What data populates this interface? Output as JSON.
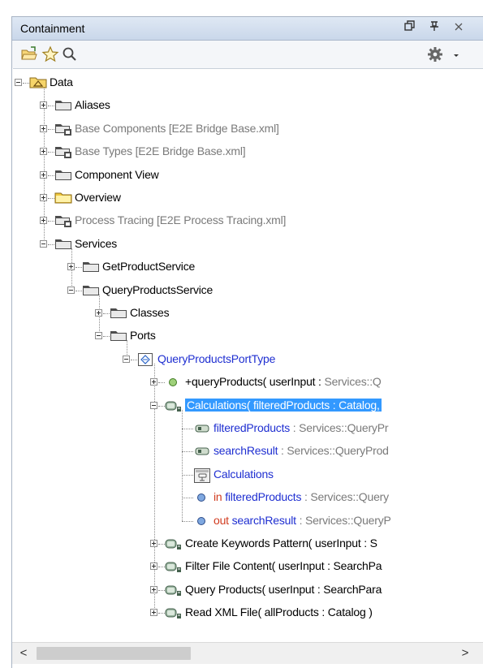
{
  "panel": {
    "title": "Containment",
    "buttons": {
      "restore": "⊡",
      "pin": "⊥",
      "close": "✕"
    }
  },
  "toolbar": {
    "icons": [
      "open-folder-icon",
      "star-icon",
      "search-icon",
      "gear-icon",
      "dropdown-arrow-icon"
    ]
  },
  "tree": {
    "nodes": [
      {
        "label": "Data",
        "type": "package-root"
      },
      {
        "label": "Aliases",
        "type": "package"
      },
      {
        "label": "Base Components [E2E Bridge Base.xml]",
        "type": "package-linked",
        "muted": true
      },
      {
        "label": "Base Types [E2E Bridge Base.xml]",
        "type": "package-linked",
        "muted": true
      },
      {
        "label": "Component View",
        "type": "package"
      },
      {
        "label": "Overview",
        "type": "package-yellow"
      },
      {
        "label": "Process Tracing [E2E Process Tracing.xml]",
        "type": "package-linked",
        "muted": true
      },
      {
        "label": "Services",
        "type": "package"
      },
      {
        "label": "GetProductService",
        "type": "package"
      },
      {
        "label": "QueryProductsService",
        "type": "package"
      },
      {
        "label": "Classes",
        "type": "package"
      },
      {
        "label": "Ports",
        "type": "package"
      },
      {
        "label": "QueryProductsPortType",
        "type": "port-type"
      },
      {
        "label": "+queryProducts( userInput : ",
        "extra": "Services::Q",
        "type": "operation"
      },
      {
        "label": "Calculations( filteredProducts : Catalog,",
        "type": "activity",
        "selected": true
      },
      {
        "label": "filteredProducts",
        "extra": " : Services::QueryPr",
        "type": "pin"
      },
      {
        "label": "searchResult",
        "extra": " : Services::QueryProd",
        "type": "pin"
      },
      {
        "label": "Calculations",
        "type": "diagram"
      },
      {
        "prefix": "in ",
        "label": "filteredProducts",
        "extra": " : Services::Query",
        "type": "parameter"
      },
      {
        "prefix": "out ",
        "label": "searchResult",
        "extra": " : Services::QueryP",
        "type": "parameter"
      },
      {
        "label": "Create Keywords Pattern( userInput : S",
        "type": "activity"
      },
      {
        "label": "Filter File Content( userInput : SearchPa",
        "type": "activity"
      },
      {
        "label": "Query Products( userInput : SearchPara",
        "type": "activity"
      },
      {
        "label": "Read XML File( allProducts : Catalog )",
        "type": "activity"
      }
    ]
  },
  "scrollbar": {
    "left": "<",
    "right": ">"
  },
  "colors": {
    "accent": "#3399ff",
    "link": "#1f2fd1",
    "muted": "#7a7a7a",
    "out": "#d13b1f"
  }
}
